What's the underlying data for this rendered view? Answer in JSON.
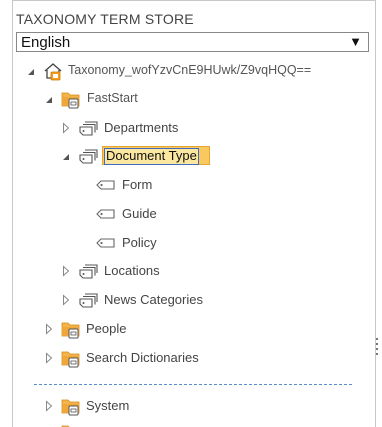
{
  "header": {
    "title": "TAXONOMY TERM STORE"
  },
  "language_select": {
    "value": "English",
    "arrow": "▼"
  },
  "tree": {
    "root": {
      "label": "Taxonomy_wofYzvCnE9HUwk/Z9vqHQQ==",
      "icon": "taxonomy-root-icon"
    },
    "group_faststart": {
      "label": "FastStart",
      "icon": "folder-group-icon"
    },
    "set_departments": {
      "label": "Departments",
      "icon": "term-set-icon"
    },
    "set_document_type": {
      "label": "Document Type",
      "icon": "term-set-icon"
    },
    "term_form": {
      "label": "Form",
      "icon": "term-tag-icon"
    },
    "term_guide": {
      "label": "Guide",
      "icon": "term-tag-icon"
    },
    "term_policy": {
      "label": "Policy",
      "icon": "term-tag-icon"
    },
    "set_locations": {
      "label": "Locations",
      "icon": "term-set-icon"
    },
    "set_news_categories": {
      "label": "News Categories",
      "icon": "term-set-icon"
    },
    "group_people": {
      "label": "People",
      "icon": "folder-group-icon"
    },
    "group_search_dictionaries": {
      "label": "Search Dictionaries",
      "icon": "folder-group-icon"
    },
    "group_system": {
      "label": "System",
      "icon": "folder-group-icon"
    }
  },
  "colors": {
    "folder": "#f0a73a",
    "selection": "#f9c960",
    "divider": "#5a8fd0",
    "text": "#444444"
  }
}
